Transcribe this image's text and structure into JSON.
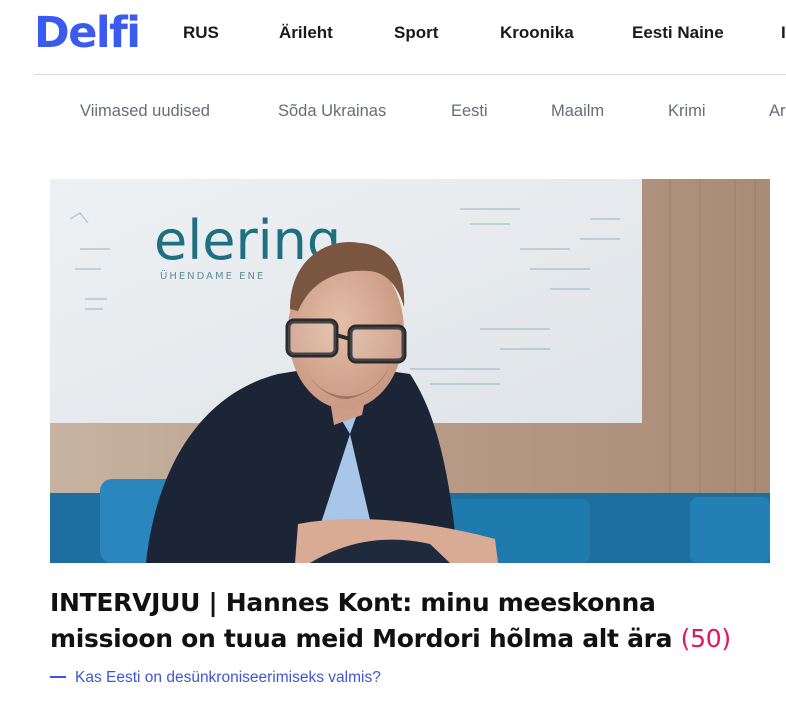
{
  "brand": {
    "logo_text": "Delfi",
    "color": "#3b5bf0"
  },
  "top_nav": {
    "items": [
      {
        "label": "RUS"
      },
      {
        "label": "Ärileht"
      },
      {
        "label": "Sport"
      },
      {
        "label": "Kroonika"
      },
      {
        "label": "Eesti Naine"
      },
      {
        "label": "I"
      }
    ]
  },
  "sub_nav": {
    "items": [
      {
        "label": "Viimased uudised"
      },
      {
        "label": "Sõda Ukrainas"
      },
      {
        "label": "Eesti"
      },
      {
        "label": "Maailm"
      },
      {
        "label": "Krimi"
      },
      {
        "label": "Ar"
      }
    ]
  },
  "article": {
    "image": {
      "sign_text": "elering",
      "sign_subtext": "ÜHENDAME ENE"
    },
    "headline": "INTERVJUU | Hannes Kont: minu meeskonna missioon on tuua meid Mordori hõlma alt ära",
    "comment_count": "(50)",
    "related_link": "Kas Eesti on desünkroniseerimiseks valmis?"
  },
  "colors": {
    "accent": "#3b5bf0",
    "comment_count": "#e5155b",
    "related_link": "#3c56d6"
  }
}
